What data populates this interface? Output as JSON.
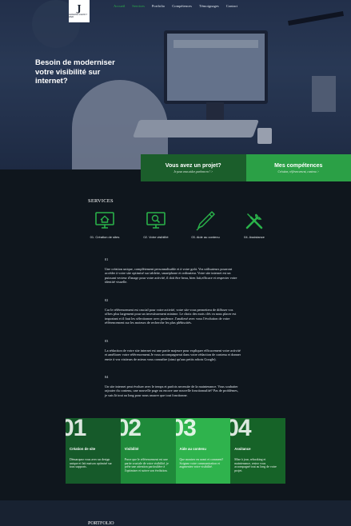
{
  "nav": {
    "logo_letter": "J",
    "logo_sub": "JEREMIE AGENCY WEB",
    "items": [
      {
        "label": "Accueil",
        "active": true
      },
      {
        "label": "Services",
        "active": true
      },
      {
        "label": "Portfolio",
        "active": false
      },
      {
        "label": "Compétences",
        "active": false
      },
      {
        "label": "Témoignages",
        "active": false
      },
      {
        "label": "Contact",
        "active": false
      }
    ]
  },
  "hero": {
    "title": "Besoin de moderniser votre visibilité sur internet?"
  },
  "cta": {
    "project_title": "Vous avez un projet?",
    "project_sub": "Je peux vous aider, parlons-en ! >",
    "skills_title": "Mes compétences",
    "skills_sub": "Création, référencement, contenu >"
  },
  "services": {
    "title": "SERVICES",
    "items": [
      {
        "label": "01. Création de sites",
        "icon": "monitor-home-icon"
      },
      {
        "label": "02. Votre visibilité",
        "icon": "monitor-search-icon"
      },
      {
        "label": "03. Aide au contenu",
        "icon": "pen-icon"
      },
      {
        "label": "04. Assistance",
        "icon": "tools-icon"
      }
    ]
  },
  "details": [
    {
      "num": "01",
      "text": "Une création unique, complètement personnalisable et à votre goût. Vos utilisateurs pourront accéder à votre site optimisé sur tablette, smartphone et ordinateur. Votre site internet est un puissant vecteur d'image pour votre activité, il doit être beau, bien fait,efficace et respecter votre identité visuelle."
    },
    {
      "num": "02",
      "text": "Car le référencement est crucial pour votre activité, votre site vous permettera de diffuser vos offres plus largement pour un investissement minime. Le choix des mots clés va nous placer est important et il faut les sélectionner avec prudence. J'analiesé avec vous l'évolution de votre référencement sur les moteurs de recherche les plus plébiscités."
    },
    {
      "num": "03",
      "text": "La rédaction de votre site internet est une partie majeure pour expliquer efficacement votre activité et améliorer votre référencement.Je vous accompagnerai dans votre rédaction de contenu et donner envie à vos visiteurs de mieux vous connaître (ainsi qu'aux petits robots Google)."
    },
    {
      "num": "04",
      "text": "Un site internet peut évoluer avec le temps et parfois necessite de la maintenance. Vous souhaiter rajouter du contenu, une nouvelle page ou encore une nouvelle fonctionnalité? Pas de problèmes, je suis là tout au long pour nous assurer que tout fonctionne."
    }
  ],
  "cards": [
    {
      "big": "01",
      "title": "Création de site",
      "text": "Démarquez vous avec un design unique et fait maison optimisé sur tous supports."
    },
    {
      "big": "02",
      "title": "Visibilité",
      "text": "Parce que le référencement est une partie cruciale de votre visibilité, je prête une attention particulière à l'optimiser et suivre son évolution."
    },
    {
      "big": "03",
      "title": "Aide au contenu",
      "text": "Que montrer en avant et comment? Soignez votre communication et augmentez votre visibilité."
    },
    {
      "big": "04",
      "title": "Assitance",
      "text": "Mise à jour, rebooking et maintenance, restez vous accompagné tout au long de votre projet."
    }
  ],
  "portfolio": {
    "title": "PORTFOLIO"
  },
  "colors": {
    "accent": "#2ab24a",
    "dark_green": "#1b5e2b",
    "page_bg": "#0f161d"
  }
}
